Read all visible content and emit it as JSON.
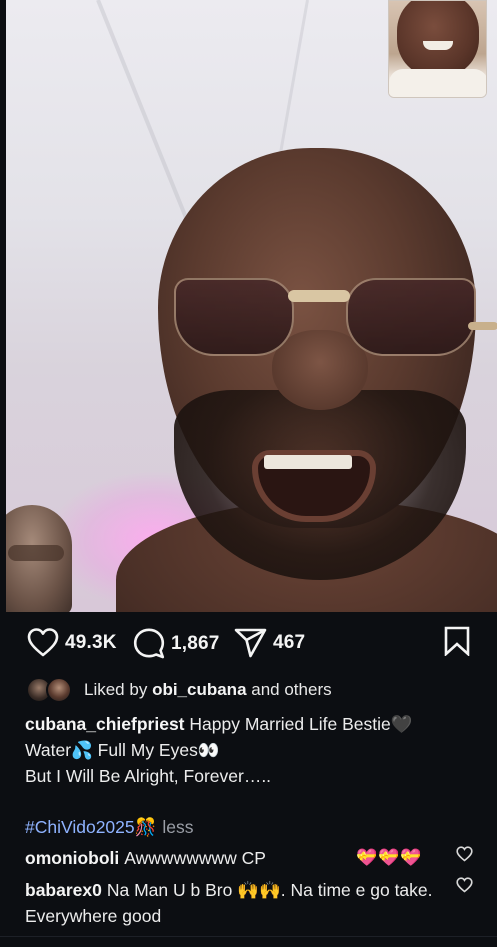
{
  "post": {
    "likes": "49.3K",
    "comments": "1,867",
    "shares": "467"
  },
  "liked_by": {
    "prefix": "Liked by",
    "user": "obi_cubana",
    "suffix": "and others"
  },
  "caption": {
    "user": "cubana_chiefpriest",
    "line1": "Happy Married Life Bestie🖤",
    "line2": "Water💦 Full My Eyes👀",
    "line3": "But I Will Be Alright, Forever…..",
    "hashtag": "#ChiVido2025🎊",
    "less": "less"
  },
  "comments_list": [
    {
      "user": "omonioboli",
      "text": "Awwwwwwww CP",
      "emoji": "💝💝💝"
    },
    {
      "user": "babarex0",
      "text": "Na Man U b Bro 🙌🙌. Na time e go take. Everywhere good"
    }
  ],
  "icons": {
    "like": "heart-icon",
    "comment": "comment-bubble-icon",
    "share": "paper-plane-icon",
    "save": "bookmark-icon"
  },
  "colors": {
    "background": "#0c0e12",
    "hashtag": "#8fb3ff",
    "muted": "#9a9ea6"
  }
}
